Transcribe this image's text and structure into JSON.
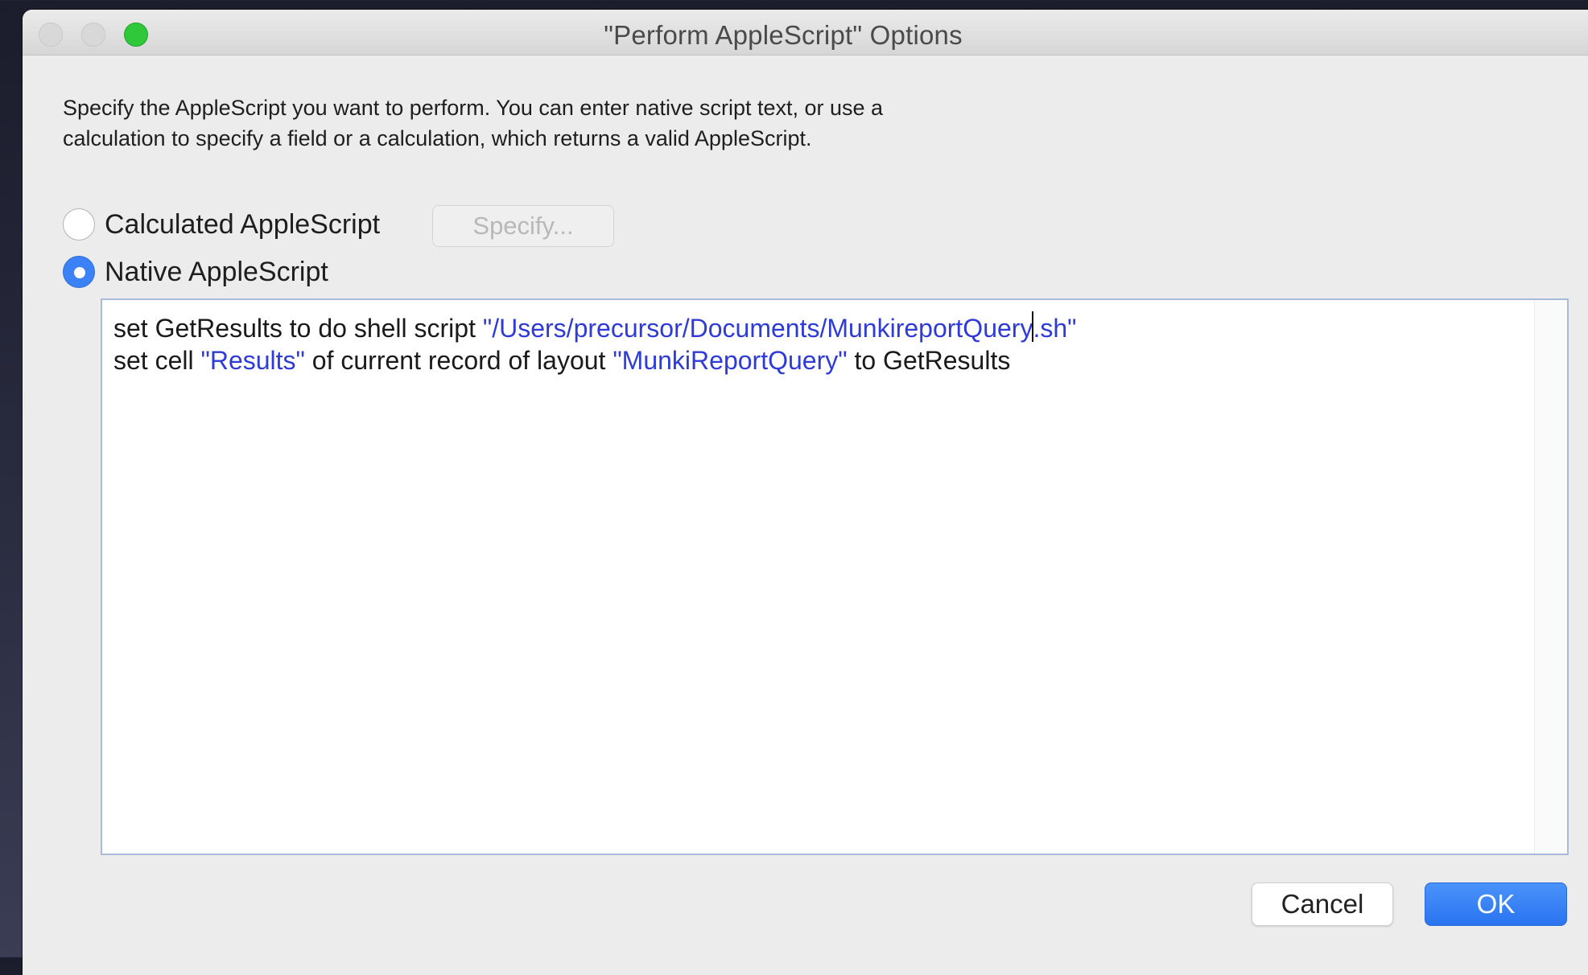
{
  "window": {
    "title": "\"Perform AppleScript\" Options"
  },
  "description": {
    "line1": "Specify the AppleScript you want to perform. You can enter native script text, or use a",
    "line2": "calculation to specify a field or a calculation, which returns a valid AppleScript."
  },
  "options": {
    "calculated": {
      "label": "Calculated AppleScript",
      "selected": false
    },
    "native": {
      "label": "Native AppleScript",
      "selected": true
    },
    "specify_label": "Specify..."
  },
  "script": {
    "line1": {
      "a": "set GetResults to do shell script ",
      "b": "\"/Users/precursor/Documents/MunkireportQuery",
      "c": ".sh\""
    },
    "line2": {
      "a": "set cell ",
      "b": "\"Results\"",
      "c": " of current record of layout ",
      "d": "\"MunkiReportQuery\"",
      "e": " to GetResults"
    }
  },
  "buttons": {
    "cancel": "Cancel",
    "ok": "OK"
  },
  "colors": {
    "accent": "#3a82f6",
    "string_literal": "#2f3bd6",
    "zoom_button": "#2ec83a"
  }
}
